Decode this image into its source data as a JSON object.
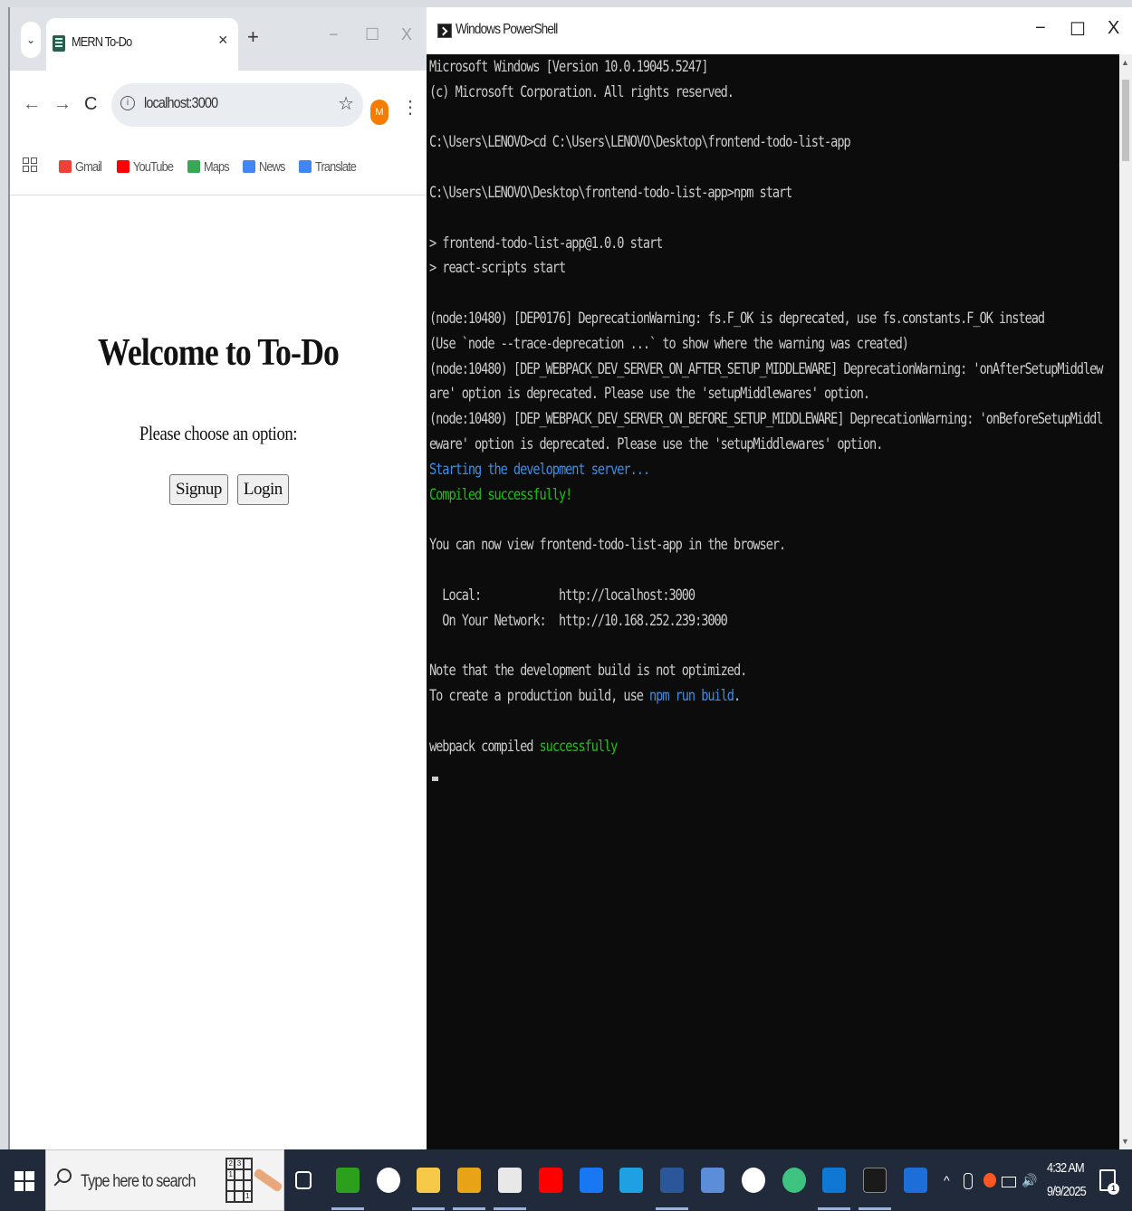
{
  "browser": {
    "tab": {
      "title": "MERN To-Do",
      "close": "×"
    },
    "new_tab": "+",
    "window": {
      "minimize": "−",
      "maximize": "☐",
      "close": "X"
    },
    "toolbar": {
      "back": "←",
      "forward": "→",
      "reload": "C",
      "url": "localhost:3000",
      "star": "☆",
      "avatar": "M",
      "menu": "⋮"
    },
    "bookmarks": [
      {
        "label": "Gmail",
        "icon": "gmail-icon",
        "color": "#ea4335"
      },
      {
        "label": "YouTube",
        "icon": "youtube-icon",
        "color": "#ff0000"
      },
      {
        "label": "Maps",
        "icon": "maps-icon",
        "color": "#34a853"
      },
      {
        "label": "News",
        "icon": "news-icon",
        "color": "#4285f4"
      },
      {
        "label": "Translate",
        "icon": "translate-icon",
        "color": "#4285f4"
      }
    ],
    "page": {
      "heading": "Welcome to To-Do",
      "subtitle": "Please choose an option:",
      "signup_label": "Signup",
      "login_label": "Login"
    }
  },
  "powershell": {
    "title": "Windows PowerShell",
    "window": {
      "minimize": "−",
      "maximize": "☐",
      "close": "X"
    },
    "lines": [
      {
        "text": "Microsoft Windows [Version 10.0.19045.5247]",
        "color": "default"
      },
      {
        "text": "(c) Microsoft Corporation. All rights reserved.",
        "color": "default"
      },
      {
        "text": "",
        "color": "default"
      },
      {
        "text": "C:\\Users\\LENOVO>cd C:\\Users\\LENOVO\\Desktop\\frontend-todo-list-app",
        "color": "default"
      },
      {
        "text": "",
        "color": "default"
      },
      {
        "text": "C:\\Users\\LENOVO\\Desktop\\frontend-todo-list-app>npm start",
        "color": "default"
      },
      {
        "text": "",
        "color": "default"
      },
      {
        "text": "> frontend-todo-list-app@1.0.0 start",
        "color": "default"
      },
      {
        "text": "> react-scripts start",
        "color": "default"
      },
      {
        "text": "",
        "color": "default"
      },
      {
        "text": "(node:10480) [DEP0176] DeprecationWarning: fs.F_OK is deprecated, use fs.constants.F_OK instead",
        "color": "default"
      },
      {
        "text": "(Use `node --trace-deprecation ...` to show where the warning was created)",
        "color": "default"
      },
      {
        "text": "(node:10480) [DEP_WEBPACK_DEV_SERVER_ON_AFTER_SETUP_MIDDLEWARE] DeprecationWarning: 'onAfterSetupMiddlew",
        "color": "default"
      },
      {
        "text": "are' option is deprecated. Please use the 'setupMiddlewares' option.",
        "color": "default"
      },
      {
        "text": "(node:10480) [DEP_WEBPACK_DEV_SERVER_ON_BEFORE_SETUP_MIDDLEWARE] DeprecationWarning: 'onBeforeSetupMiddl",
        "color": "default"
      },
      {
        "text": "eware' option is deprecated. Please use the 'setupMiddlewares' option.",
        "color": "default"
      },
      {
        "text": "Starting the development server...",
        "color": "blue"
      },
      {
        "text": "Compiled successfully!",
        "color": "green"
      },
      {
        "text": "",
        "color": "default"
      },
      {
        "text": "You can now view frontend-todo-list-app in the browser.",
        "color": "default"
      },
      {
        "text": "",
        "color": "default"
      },
      {
        "text": "  Local:            http://localhost:3000",
        "color": "default"
      },
      {
        "text": "  On Your Network:  http://10.168.252.239:3000",
        "color": "default"
      },
      {
        "text": "",
        "color": "default"
      },
      {
        "text": "Note that the development build is not optimized.",
        "color": "default"
      },
      {
        "text": "To create a production build, use ",
        "color": "default",
        "suffix": "npm run build",
        "suffix_color": "blue",
        "tail": "."
      },
      {
        "text": "",
        "color": "default"
      },
      {
        "text": "webpack compiled ",
        "color": "default",
        "suffix": "successfully",
        "suffix_color": "green",
        "tail": ""
      }
    ],
    "colors": {
      "default": "#cccccc",
      "blue": "#3b8eea",
      "green": "#16c60c",
      "background": "#0c0c0c"
    }
  },
  "taskbar": {
    "search_placeholder": "Type here to search",
    "sudoku_cells": [
      "2",
      "3",
      "",
      "1",
      "",
      "",
      "",
      "",
      "",
      "",
      "",
      "1"
    ],
    "apps": [
      {
        "name": "task-view-icon",
        "color": "#ffffff"
      },
      {
        "name": "quickbooks-icon",
        "color": "#2ca01c"
      },
      {
        "name": "chatgpt-icon",
        "color": "#ffffff"
      },
      {
        "name": "file-explorer-icon",
        "color": "#f7c948"
      },
      {
        "name": "chrome-icon",
        "color": "#e8a317"
      },
      {
        "name": "notepad-icon",
        "color": "#e8e8e8"
      },
      {
        "name": "youtube-icon",
        "color": "#ff0000"
      },
      {
        "name": "facebook-icon",
        "color": "#1877f2"
      },
      {
        "name": "edge-icon",
        "color": "#1fa0e3"
      },
      {
        "name": "word-icon",
        "color": "#2b579a"
      },
      {
        "name": "app-icon",
        "color": "#5b8dd9"
      },
      {
        "name": "github-icon",
        "color": "#ffffff"
      },
      {
        "name": "circle-app-icon",
        "color": "#3fc380"
      },
      {
        "name": "outlook-icon",
        "color": "#0f78d4"
      },
      {
        "name": "terminal-icon",
        "color": "#1a1a1a"
      },
      {
        "name": "paint-icon",
        "color": "#1e6ed9"
      }
    ],
    "tray": {
      "chevron": "^",
      "volume": "🔊"
    },
    "clock": {
      "time": "4:32 AM",
      "date": "9/9/2025"
    },
    "notification_count": "1"
  }
}
